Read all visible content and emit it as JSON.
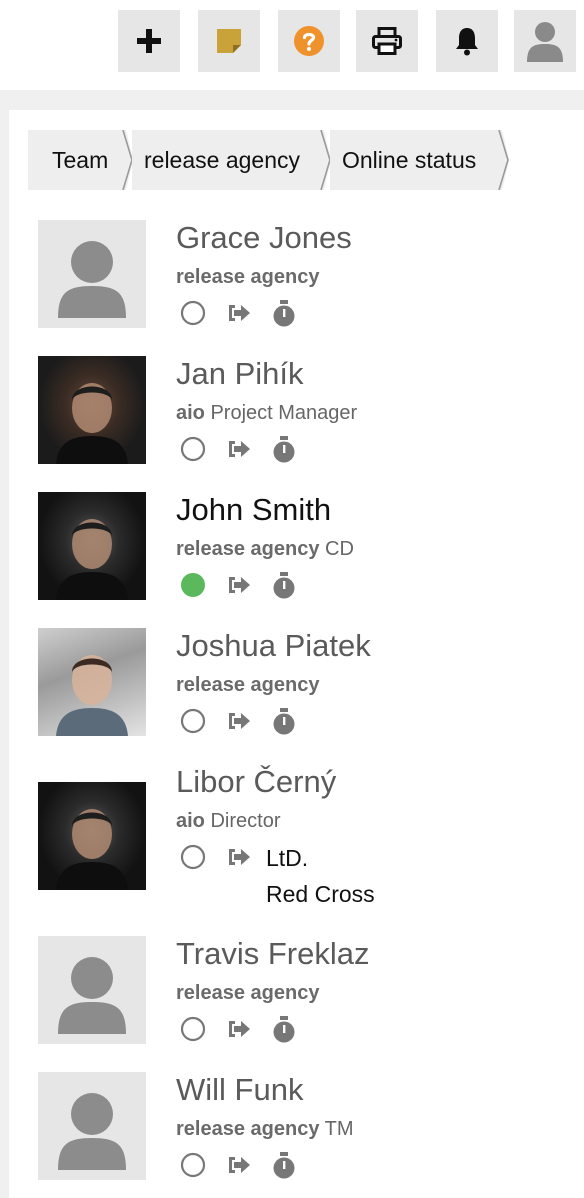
{
  "toolbar": {
    "buttons": [
      {
        "icon": "plus-icon"
      },
      {
        "icon": "sticky-note-icon"
      },
      {
        "icon": "help-icon"
      },
      {
        "icon": "printer-icon"
      },
      {
        "icon": "bell-icon"
      },
      {
        "icon": "user-avatar-icon"
      }
    ]
  },
  "breadcrumb": {
    "items": [
      "Team",
      "release agency",
      "Online status"
    ]
  },
  "colors": {
    "online": "#5cb85c",
    "help": "#f0922b",
    "note": "#c9a33a"
  },
  "people": [
    {
      "name": "Grace Jones",
      "company": "release agency",
      "role": "",
      "online": false,
      "avatar": "placeholder"
    },
    {
      "name": "Jan Pihík",
      "company": "aio",
      "role": " Project Manager",
      "online": false,
      "avatar": "photo"
    },
    {
      "name": "John Smith",
      "company": "release agency",
      "role": " CD",
      "online": true,
      "avatar": "photo"
    },
    {
      "name": "Joshua Piatek",
      "company": "release agency",
      "role": "",
      "online": false,
      "avatar": "photo"
    },
    {
      "name": "Libor Černý",
      "company": "aio",
      "role": " Director",
      "online": false,
      "avatar": "photo",
      "project_lines": [
        "LtD.",
        "Red Cross"
      ]
    },
    {
      "name": "Travis Freklaz",
      "company": "release agency",
      "role": "",
      "online": false,
      "avatar": "placeholder"
    },
    {
      "name": "Will Funk",
      "company": "release agency",
      "role": " TM",
      "online": false,
      "avatar": "placeholder"
    }
  ]
}
